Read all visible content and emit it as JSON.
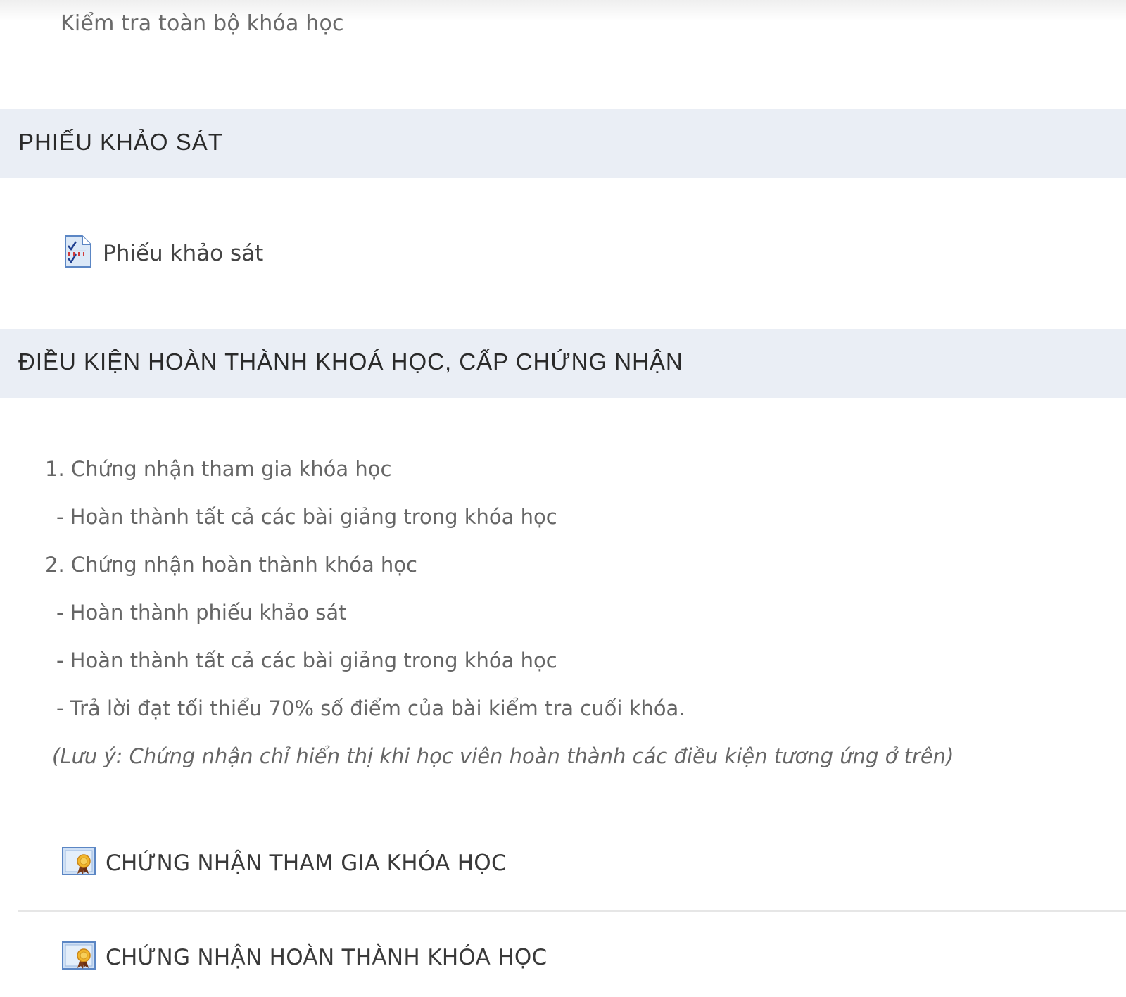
{
  "top": {
    "text": "Kiểm tra toàn bộ khóa học"
  },
  "sections": [
    {
      "title": "PHIẾU KHẢO SÁT",
      "activities": [
        {
          "label": "Phiếu khảo sát",
          "icon": "survey-icon"
        }
      ]
    },
    {
      "title": "ĐIỀU KIỆN HOÀN THÀNH KHOÁ HỌC, CẤP CHỨNG NHẬN",
      "conditions": [
        "1. Chứng nhận tham gia khóa học",
        "- Hoàn thành tất cả các bài giảng trong khóa học",
        "2. Chứng nhận hoàn thành khóa học",
        "- Hoàn thành phiếu khảo sát",
        "- Hoàn thành tất cả các bài giảng trong khóa học",
        "- Trả lời đạt tối thiểu 70% số điểm của bài kiểm tra cuối khóa."
      ],
      "note": "(Lưu ý: Chứng nhận chỉ hiển thị khi học viên hoàn thành các điều kiện tương ứng ở trên)",
      "activities": [
        {
          "label": "CHỨNG NHẬN THAM GIA KHÓA HỌC",
          "icon": "certificate-icon"
        },
        {
          "label": "CHỨNG NHẬN HOÀN THÀNH KHÓA HỌC",
          "icon": "certificate-icon"
        }
      ]
    }
  ],
  "colors": {
    "section_header_bg": "#eaeef5",
    "text": "#666666",
    "heading": "#2a2a2a"
  }
}
